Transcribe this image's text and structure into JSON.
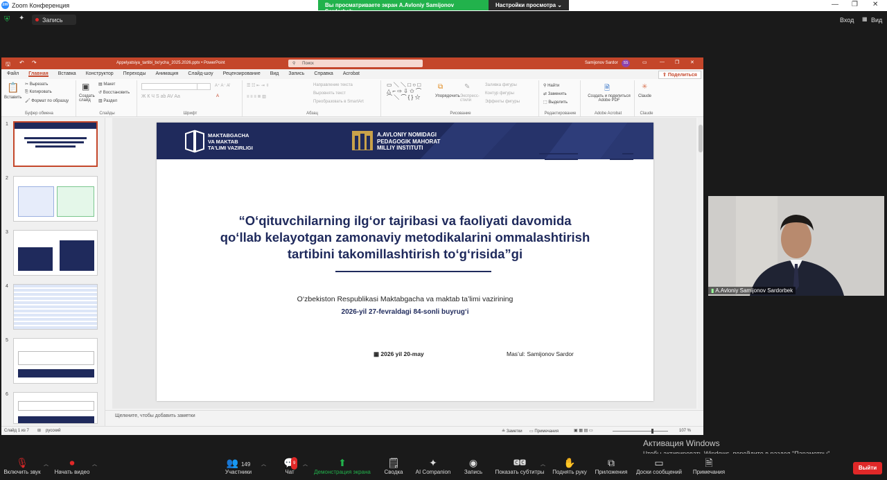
{
  "zoom": {
    "app_title": "Zoom Конференция",
    "share_banner": "Вы просматриваете экран A.Avloniy Samijonov Sardorbek",
    "view_options": "Настройки просмотра",
    "record_label": "Запись",
    "enter_label": "Вход",
    "view_label": "Вид",
    "participant_name": "A.Avloniy Samijonov Sardorbek",
    "participants_count": "149",
    "chat_badge": "9"
  },
  "ppt": {
    "file_title": "Appelyatsiya_tartibi_bo'ycha_2025.2026.pptx  •  PowerPoint",
    "search_placeholder": "Поиск",
    "user_name": "Samijonov Sardor",
    "user_initials": "SS",
    "share_btn": "Поделиться",
    "menu": [
      "Файл",
      "Главная",
      "Вставка",
      "Конструктор",
      "Переходы",
      "Анимация",
      "Слайд-шоу",
      "Рецензирование",
      "Вид",
      "Запись",
      "Справка",
      "Acrobat"
    ],
    "ribbon": {
      "paste": "Вставить",
      "cut": "Вырезать",
      "copy": "Копировать",
      "format_painter": "Формат по образцу",
      "clipboard_group": "Буфер обмена",
      "new_slide": "Создать слайд",
      "layout": "Макет",
      "reset": "Восстановить",
      "section": "Раздел",
      "slides_group": "Слайды",
      "font_group": "Шрифт",
      "text_direction": "Направление текста",
      "align_text": "Выровнять текст",
      "smartart": "Преобразовать в SmartArt",
      "paragraph_group": "Абзац",
      "arrange": "Упорядочить",
      "quick_styles": "Экспресс-стили",
      "shape_fill": "Заливка фигуры",
      "shape_outline": "Контур фигуры",
      "shape_effects": "Эффекты фигуры",
      "drawing_group": "Рисование",
      "find": "Найти",
      "replace": "Заменить",
      "select": "Выделить",
      "editing_group": "Редактирование",
      "create_pdf": "Создать и поделиться Adobe PDF",
      "acrobat_group": "Adobe Acrobat",
      "claude": "Claude",
      "claude_group": "Claude"
    },
    "slide_numbers": [
      "1",
      "2",
      "3",
      "4",
      "5",
      "6"
    ],
    "notes_placeholder": "Щелкните, чтобы добавить заметки",
    "status": {
      "slide": "Слайд 1 из 7",
      "lang": "русский",
      "notes": "Заметки",
      "comments": "Примечания",
      "zoom": "107 %"
    }
  },
  "slide": {
    "org1": [
      "MAKTABGACHA",
      "VA MAKTAB",
      "TA'LIMI VAZIRLIGI"
    ],
    "org2": [
      "A.AVLONIY NOMIDAGI",
      "PEDAGOGIK MAHORAT",
      "MILLIY INSTITUTI"
    ],
    "title_lines": [
      "“O‘qituvchilarning ilg‘or tajribasi va faoliyati davomida",
      "qo‘llab kelayotgan zamonaviy metodikalarini ommalashtirish",
      "tartibini takomillashtirish to‘g‘risida”gi"
    ],
    "subtitle": "O‘zbekiston Respublikasi Maktabgacha va maktab ta’limi vazirining",
    "order": "2026-yil 27-fevraldagi 84-sonli buyrug‘i",
    "date": "2026 yil 20-may",
    "resp_label": "Mas’ul:",
    "resp_name": "Samijonov Sardor"
  },
  "toolbar": {
    "mute": "Включить звук",
    "video": "Начать видео",
    "participants": "Участники",
    "chat": "Чат",
    "share": "Демонстрация экрана",
    "summary": "Сводка",
    "ai": "AI Companion",
    "record": "Запись",
    "captions": "Показать субтитры",
    "raise": "Поднять руку",
    "apps": "Приложения",
    "boards": "Доски сообщений",
    "notes": "Примечания",
    "leave": "Выйти"
  },
  "activation": {
    "line1": "Активация Windows",
    "line2": "Чтобы активировать Windows, перейдите в раздел \"Параметры\"."
  },
  "colors": {
    "zoom_green": "#22b24c",
    "ppt_red": "#c4462a",
    "slide_navy": "#1f2a5c",
    "leave_red": "#e02828"
  }
}
